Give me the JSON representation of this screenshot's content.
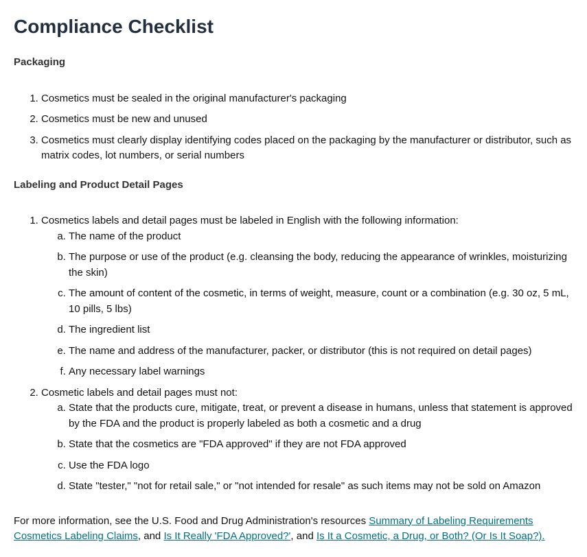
{
  "title": "Compliance Checklist",
  "sections": {
    "packaging": {
      "heading": "Packaging",
      "items": [
        "Cosmetics must be sealed in the original manufacturer's packaging",
        "Cosmetics must be new and unused",
        "Cosmetics must clearly display identifying codes placed on the packaging by the manufacturer or distributor, such as matrix codes, lot numbers, or serial numbers"
      ]
    },
    "labeling": {
      "heading": "Labeling and Product Detail Pages",
      "list1": {
        "intro": "Cosmetics labels and detail pages must be labeled in English with the following information:",
        "items": [
          "The name of the product",
          "The purpose or use of the product (e.g. cleansing the body, reducing the appearance of wrinkles, moisturizing the skin)",
          "The amount of content of the cosmetic, in terms of weight, measure, count or a combination (e.g. 30 oz, 5 mL, 10 pills, 5 lbs)",
          "The ingredient list",
          "The name and address of the manufacturer, packer, or distributor (this is not required on detail pages)",
          "Any necessary label warnings"
        ]
      },
      "list2": {
        "intro": "Cosmetic labels and detail pages must not:",
        "items": [
          "State that the products cure, mitigate, treat, or prevent a disease in humans, unless that statement is approved by the FDA and the product is properly labeled as both a cosmetic and a drug",
          "State that the cosmetics are \"FDA approved\" if they are not FDA approved",
          "Use the FDA logo",
          "State \"tester,\" \"not for retail sale,\" or \"not intended for resale\" as such items may not be sold on Amazon"
        ]
      }
    }
  },
  "footer": {
    "prefix": "For more information, see the U.S. Food and Drug Administration's resources ",
    "link1": "Summary of Labeling Requirements Cosmetics Labeling Claims",
    "mid1": ", and ",
    "link2": "Is It Really 'FDA Approved?'",
    "mid2": ", and ",
    "link3": "Is It a Cosmetic, a Drug, or Both? (Or Is It Soap?)."
  }
}
